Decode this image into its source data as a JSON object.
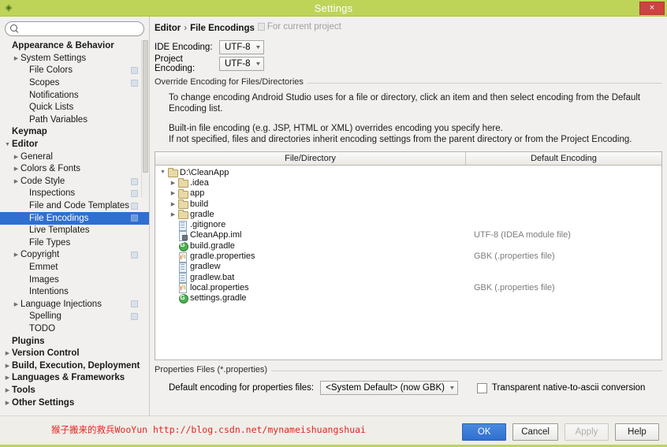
{
  "window": {
    "title": "Settings",
    "app_icon": "android-studio-icon",
    "close_label": "×",
    "accent_color": "#bdd459",
    "close_color": "#cf4242"
  },
  "search": {
    "value": "",
    "placeholder": "",
    "icon": "search-icon"
  },
  "sidebar": {
    "items": [
      {
        "label": "Appearance & Behavior",
        "bold": true,
        "indent": 0,
        "arrow": "",
        "marker": false,
        "selected": false
      },
      {
        "label": "System Settings",
        "bold": false,
        "indent": 1,
        "arrow": "▶",
        "marker": false,
        "selected": false
      },
      {
        "label": "File Colors",
        "bold": false,
        "indent": 2,
        "arrow": "",
        "marker": true,
        "selected": false
      },
      {
        "label": "Scopes",
        "bold": false,
        "indent": 2,
        "arrow": "",
        "marker": true,
        "selected": false
      },
      {
        "label": "Notifications",
        "bold": false,
        "indent": 2,
        "arrow": "",
        "marker": false,
        "selected": false
      },
      {
        "label": "Quick Lists",
        "bold": false,
        "indent": 2,
        "arrow": "",
        "marker": false,
        "selected": false
      },
      {
        "label": "Path Variables",
        "bold": false,
        "indent": 2,
        "arrow": "",
        "marker": false,
        "selected": false
      },
      {
        "label": "Keymap",
        "bold": true,
        "indent": 0,
        "arrow": "",
        "marker": false,
        "selected": false
      },
      {
        "label": "Editor",
        "bold": true,
        "indent": 0,
        "arrow": "▼",
        "marker": false,
        "selected": false
      },
      {
        "label": "General",
        "bold": false,
        "indent": 1,
        "arrow": "▶",
        "marker": false,
        "selected": false
      },
      {
        "label": "Colors & Fonts",
        "bold": false,
        "indent": 1,
        "arrow": "▶",
        "marker": false,
        "selected": false
      },
      {
        "label": "Code Style",
        "bold": false,
        "indent": 1,
        "arrow": "▶",
        "marker": true,
        "selected": false
      },
      {
        "label": "Inspections",
        "bold": false,
        "indent": 2,
        "arrow": "",
        "marker": true,
        "selected": false
      },
      {
        "label": "File and Code Templates",
        "bold": false,
        "indent": 2,
        "arrow": "",
        "marker": true,
        "selected": false
      },
      {
        "label": "File Encodings",
        "bold": false,
        "indent": 2,
        "arrow": "",
        "marker": true,
        "selected": true
      },
      {
        "label": "Live Templates",
        "bold": false,
        "indent": 2,
        "arrow": "",
        "marker": false,
        "selected": false
      },
      {
        "label": "File Types",
        "bold": false,
        "indent": 2,
        "arrow": "",
        "marker": false,
        "selected": false
      },
      {
        "label": "Copyright",
        "bold": false,
        "indent": 1,
        "arrow": "▶",
        "marker": true,
        "selected": false
      },
      {
        "label": "Emmet",
        "bold": false,
        "indent": 2,
        "arrow": "",
        "marker": false,
        "selected": false
      },
      {
        "label": "Images",
        "bold": false,
        "indent": 2,
        "arrow": "",
        "marker": false,
        "selected": false
      },
      {
        "label": "Intentions",
        "bold": false,
        "indent": 2,
        "arrow": "",
        "marker": false,
        "selected": false
      },
      {
        "label": "Language Injections",
        "bold": false,
        "indent": 1,
        "arrow": "▶",
        "marker": true,
        "selected": false
      },
      {
        "label": "Spelling",
        "bold": false,
        "indent": 2,
        "arrow": "",
        "marker": true,
        "selected": false
      },
      {
        "label": "TODO",
        "bold": false,
        "indent": 2,
        "arrow": "",
        "marker": false,
        "selected": false
      },
      {
        "label": "Plugins",
        "bold": true,
        "indent": 0,
        "arrow": "",
        "marker": false,
        "selected": false
      },
      {
        "label": "Version Control",
        "bold": true,
        "indent": 0,
        "arrow": "▶",
        "marker": false,
        "selected": false
      },
      {
        "label": "Build, Execution, Deployment",
        "bold": true,
        "indent": 0,
        "arrow": "▶",
        "marker": false,
        "selected": false
      },
      {
        "label": "Languages & Frameworks",
        "bold": true,
        "indent": 0,
        "arrow": "▶",
        "marker": false,
        "selected": false
      },
      {
        "label": "Tools",
        "bold": true,
        "indent": 0,
        "arrow": "▶",
        "marker": false,
        "selected": false
      },
      {
        "label": "Other Settings",
        "bold": true,
        "indent": 0,
        "arrow": "▶",
        "marker": false,
        "selected": false
      }
    ]
  },
  "main": {
    "breadcrumb": {
      "parent": "Editor",
      "separator": "›",
      "current": "File Encodings",
      "scope": "For current project",
      "scope_icon": "project-scope-icon"
    },
    "ide_encoding": {
      "label": "IDE Encoding:",
      "value": "UTF-8"
    },
    "project_encoding": {
      "label": "Project Encoding:",
      "value": "UTF-8"
    },
    "override_section": {
      "title": "Override Encoding for Files/Directories",
      "paragraph1": "To change encoding Android Studio uses for a file or directory, click an item and then select encoding from the Default Encoding list.",
      "paragraph2": "Built-in file encoding (e.g. JSP, HTML or XML) overrides encoding you specify here.",
      "paragraph3": "If not specified, files and directories inherit encoding settings from the parent directory or from the Project Encoding."
    },
    "table": {
      "columns": [
        "File/Directory",
        "Default Encoding"
      ],
      "rows": [
        {
          "name": "D:\\CleanApp",
          "indent": 0,
          "arrow": "▼",
          "icon": "folder",
          "encoding": ""
        },
        {
          "name": ".idea",
          "indent": 1,
          "arrow": "▶",
          "icon": "folder",
          "encoding": ""
        },
        {
          "name": "app",
          "indent": 1,
          "arrow": "▶",
          "icon": "folder",
          "encoding": ""
        },
        {
          "name": "build",
          "indent": 1,
          "arrow": "▶",
          "icon": "folder",
          "encoding": ""
        },
        {
          "name": "gradle",
          "indent": 1,
          "arrow": "▶",
          "icon": "folder",
          "encoding": ""
        },
        {
          "name": ".gitignore",
          "indent": 1,
          "arrow": "",
          "icon": "doc",
          "encoding": ""
        },
        {
          "name": "CleanApp.iml",
          "indent": 1,
          "arrow": "",
          "icon": "iml",
          "encoding": "UTF-8 (IDEA module file)"
        },
        {
          "name": "build.gradle",
          "indent": 1,
          "arrow": "",
          "icon": "gradle",
          "encoding": ""
        },
        {
          "name": "gradle.properties",
          "indent": 1,
          "arrow": "",
          "icon": "props",
          "encoding": "GBK (.properties file)"
        },
        {
          "name": "gradlew",
          "indent": 1,
          "arrow": "",
          "icon": "doc",
          "encoding": ""
        },
        {
          "name": "gradlew.bat",
          "indent": 1,
          "arrow": "",
          "icon": "doc",
          "encoding": ""
        },
        {
          "name": "local.properties",
          "indent": 1,
          "arrow": "",
          "icon": "props",
          "encoding": "GBK (.properties file)"
        },
        {
          "name": "settings.gradle",
          "indent": 1,
          "arrow": "",
          "icon": "gradle",
          "encoding": ""
        }
      ]
    },
    "properties_section": {
      "title": "Properties Files (*.properties)",
      "default_encoding_label": "Default encoding for properties files:",
      "default_encoding_value": "<System Default> (now GBK)",
      "transparent_label": "Transparent native-to-ascii conversion",
      "transparent_checked": false
    }
  },
  "footer": {
    "watermark": "猴子搬来的救兵WooYun http://blog.csdn.net/mynameishuangshuai",
    "watermark_color": "#e8241f",
    "buttons": [
      {
        "label": "OK",
        "style": "primary"
      },
      {
        "label": "Cancel",
        "style": "normal"
      },
      {
        "label": "Apply",
        "style": "disabled"
      },
      {
        "label": "Help",
        "style": "normal"
      }
    ]
  }
}
